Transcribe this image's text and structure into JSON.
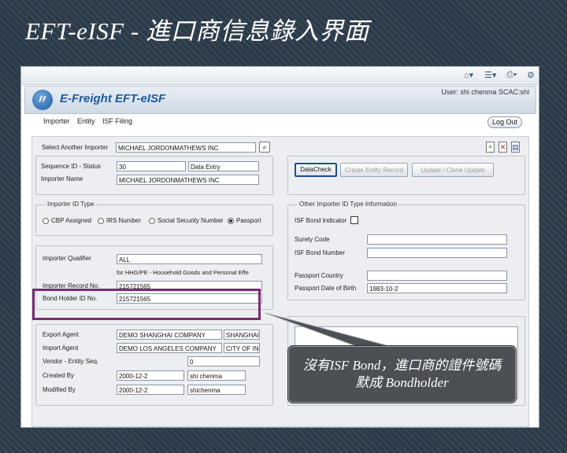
{
  "slide": {
    "title": "EFT-eISF - 進口商信息錄入界面"
  },
  "browser": {
    "icons": [
      "home-icon",
      "feed-icon",
      "print-icon",
      "tools-icon"
    ]
  },
  "app": {
    "logo_glyph": "〃",
    "name": "E-Freight  EFT-eISF",
    "user_info": "User: shi chenma SCAC:shl"
  },
  "menu": {
    "items": [
      "Importer",
      "Entity",
      "ISF Filing"
    ],
    "logout": "Log Out"
  },
  "importer": {
    "select_label": "Select Another Importer",
    "select_value": "MICHAEL JORDONMATHEWS INC",
    "seq_label": "Sequence ID - Status",
    "seq_value": "30",
    "status_value": "Data Entry",
    "name_label": "Importer Name",
    "name_value": "MICHAEL JORDONMATHEWS INC"
  },
  "actions": {
    "datacheck": "DataCheck",
    "create_entity": "Create Entity Record",
    "update_clone": "Update / Clone Update"
  },
  "id_type": {
    "title": "Importer ID Type",
    "options": [
      "CBP Assigned",
      "IRS Number",
      "Social Security Number",
      "Passport"
    ],
    "selected": "Passport"
  },
  "other_id": {
    "title": "Other Importer ID Type Information",
    "bond_indicator_label": "ISF Bond Indicator",
    "surety_label": "Surety Code",
    "bond_number_label": "ISF Bond Number",
    "passport_country_label": "Passport Country",
    "passport_date_label": "Passport Date of Birth",
    "passport_date_value": "1983-10-2"
  },
  "qualifier": {
    "label": "Importer Qualifier",
    "value": "ALL",
    "desc": "for HHG/PE - Household Goods and Personal Effe",
    "record_label": "Importer Record No.",
    "record_value": "215721565",
    "bond_label": "Bond Holder ID No.",
    "bond_value": "215721565"
  },
  "agents": {
    "export_label": "Export Agent",
    "export_value": "DEMO SHANGHAI COMPANY",
    "export_city": "SHANGHAI",
    "import_label": "Import Agent",
    "import_value": "DEMO LOS ANGELES COMPANY",
    "import_city": "CITY OF INC",
    "vendor_label": "Vendor - Entity Seq.",
    "vendor_value": "0",
    "created_label": "Created By",
    "created_date": "2000-12-2",
    "created_user": "shi chenma",
    "modified_label": "Modified By",
    "modified_date": "2000-12-2",
    "modified_user": "shichenma"
  },
  "callout": {
    "text": "沒有ISF Bond，進口商的證件號碼默成 Bondholder"
  }
}
